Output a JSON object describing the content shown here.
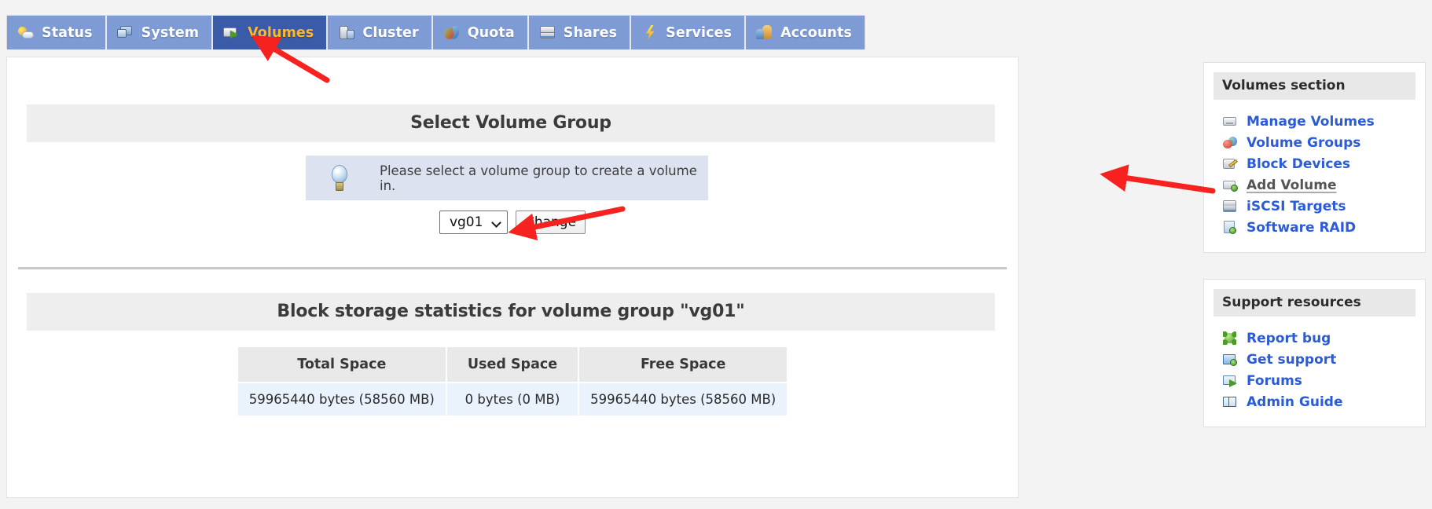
{
  "nav": {
    "tabs": [
      {
        "label": "Status",
        "icon": "weather-status-icon",
        "icon_class": "ic-status",
        "active": false
      },
      {
        "label": "System",
        "icon": "monitors-icon",
        "icon_class": "ic-system",
        "active": false
      },
      {
        "label": "Volumes",
        "icon": "volume-export-icon",
        "icon_class": "ic-volumes",
        "active": true
      },
      {
        "label": "Cluster",
        "icon": "servers-icon",
        "icon_class": "ic-cluster",
        "active": false
      },
      {
        "label": "Quota",
        "icon": "pie-slices-icon",
        "icon_class": "ic-quota",
        "active": false
      },
      {
        "label": "Shares",
        "icon": "network-drive-icon",
        "icon_class": "ic-shares",
        "active": false
      },
      {
        "label": "Services",
        "icon": "lightning-bolt-icon",
        "icon_class": "ic-services",
        "active": false
      },
      {
        "label": "Accounts",
        "icon": "users-icon",
        "icon_class": "ic-accounts",
        "active": false
      }
    ]
  },
  "main": {
    "select_section_title": "Select Volume Group",
    "hint": {
      "icon": "lightbulb-icon",
      "text": "Please select a volume group to create a volume in."
    },
    "volume_group_select": {
      "selected": "vg01",
      "options": [
        "vg01"
      ],
      "chevron_icon": "chevron-down-icon"
    },
    "change_button_label": "Change",
    "stats_section_title": "Block storage statistics for volume group \"vg01\"",
    "stats_table": {
      "headers": [
        "Total Space",
        "Used Space",
        "Free Space"
      ],
      "rows": [
        [
          "59965440 bytes (58560 MB)",
          "0 bytes (0 MB)",
          "59965440 bytes (58560 MB)"
        ]
      ]
    }
  },
  "sidebar": {
    "volumes_panel": {
      "title": "Volumes section",
      "items": [
        {
          "label": "Manage Volumes",
          "icon": "drive-icon",
          "icon_class": "li-manage",
          "current": false
        },
        {
          "label": "Volume Groups",
          "icon": "group-spheres-icon",
          "icon_class": "li-groups",
          "current": false
        },
        {
          "label": "Block Devices",
          "icon": "drive-edit-icon",
          "icon_class": "li-block",
          "current": false
        },
        {
          "label": "Add Volume",
          "icon": "drive-add-icon",
          "icon_class": "li-add",
          "current": true
        },
        {
          "label": "iSCSI Targets",
          "icon": "server-rack-icon",
          "icon_class": "li-iscsi",
          "current": false
        },
        {
          "label": "Software RAID",
          "icon": "disk-add-icon",
          "icon_class": "li-raid",
          "current": false
        }
      ]
    },
    "support_panel": {
      "title": "Support resources",
      "items": [
        {
          "label": "Report bug",
          "icon": "bug-icon",
          "icon_class": "li-bug",
          "current": false
        },
        {
          "label": "Get support",
          "icon": "support-card-icon",
          "icon_class": "li-support",
          "current": false
        },
        {
          "label": "Forums",
          "icon": "forum-mail-icon",
          "icon_class": "li-forums",
          "current": false
        },
        {
          "label": "Admin Guide",
          "icon": "book-icon",
          "icon_class": "li-guide",
          "current": false
        }
      ]
    }
  },
  "annotations": {
    "color": "#f5221f",
    "arrows": [
      {
        "name": "arrow-to-volumes-tab",
        "target": "Volumes"
      },
      {
        "name": "arrow-to-change-button",
        "target": "Change"
      },
      {
        "name": "arrow-to-add-volume-link",
        "target": "Add Volume"
      }
    ]
  },
  "colors": {
    "tab_inactive_bg": "#7f9bd5",
    "tab_active_bg": "#3a5ca8",
    "tab_active_text": "#ffb62e",
    "link_blue": "#2b5bd7",
    "hint_bg": "#dde2f0",
    "section_head_bg": "#efeeee",
    "table_cell_bg": "#eaf3fb",
    "page_bg": "#f3f3f3"
  }
}
